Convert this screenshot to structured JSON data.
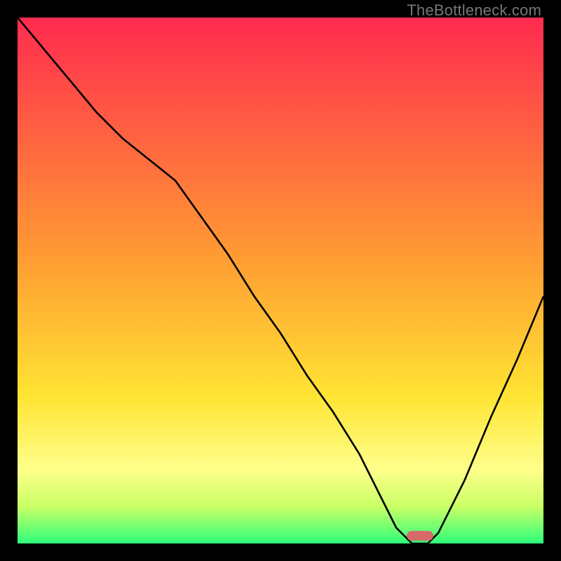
{
  "watermark": "TheBottleneck.com",
  "colors": {
    "gradient_top": "#ff2b4f",
    "gradient_mid1": "#ff7a33",
    "gradient_mid2": "#ffd733",
    "gradient_low": "#feff8a",
    "gradient_band": "#c9ff66",
    "gradient_bottom": "#2dff7a",
    "curve": "#000000",
    "marker": "#d66a6a",
    "frame": "#000000"
  },
  "chart_data": {
    "type": "line",
    "title": "",
    "xlabel": "",
    "ylabel": "",
    "xlim": [
      0,
      100
    ],
    "ylim": [
      0,
      100
    ],
    "x": [
      0,
      5,
      10,
      15,
      20,
      25,
      30,
      35,
      40,
      45,
      50,
      55,
      60,
      65,
      70,
      72,
      75,
      78,
      80,
      85,
      90,
      95,
      100
    ],
    "values": [
      100,
      94,
      88,
      82,
      77,
      73,
      69,
      62,
      55,
      47,
      40,
      32,
      25,
      17,
      7,
      3,
      0,
      0,
      2,
      12,
      24,
      35,
      47
    ],
    "marker": {
      "x": 76.5,
      "y": 1.5
    },
    "gradient_stops": [
      {
        "pos": 0.0,
        "color": "#ff2b4f"
      },
      {
        "pos": 0.45,
        "color": "#ff9a33"
      },
      {
        "pos": 0.72,
        "color": "#ffe433"
      },
      {
        "pos": 0.86,
        "color": "#feff8a"
      },
      {
        "pos": 0.93,
        "color": "#c9ff66"
      },
      {
        "pos": 1.0,
        "color": "#2dff7a"
      }
    ]
  }
}
